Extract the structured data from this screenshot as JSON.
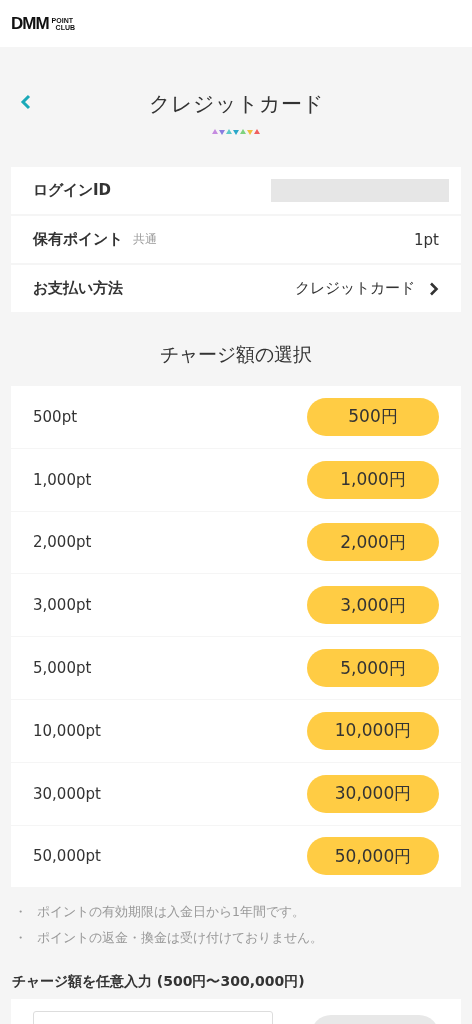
{
  "header": {
    "logo_main": "DMM",
    "logo_sub_1": "POINT",
    "logo_sub_2": "CLUB"
  },
  "page": {
    "title": "クレジットカード"
  },
  "info_rows": [
    {
      "kind": "redacted",
      "label": "ログインID"
    },
    {
      "kind": "value",
      "label": "保有ポイント",
      "note": "共通",
      "value": "1pt"
    },
    {
      "kind": "link",
      "label": "お支払い方法",
      "value": "クレジットカード"
    }
  ],
  "charge_section": {
    "title": "チャージ額の選択",
    "options": [
      {
        "points": "500pt",
        "price": "500円"
      },
      {
        "points": "1,000pt",
        "price": "1,000円"
      },
      {
        "points": "2,000pt",
        "price": "2,000円"
      },
      {
        "points": "3,000pt",
        "price": "3,000円"
      },
      {
        "points": "5,000pt",
        "price": "5,000円"
      },
      {
        "points": "10,000pt",
        "price": "10,000円"
      },
      {
        "points": "30,000pt",
        "price": "30,000円"
      },
      {
        "points": "50,000pt",
        "price": "50,000円"
      }
    ]
  },
  "notes": [
    {
      "bullet": "・",
      "text": "ポイントの有効期限は入金日から1年間です。"
    },
    {
      "bullet": "・",
      "text": "ポイントの返金・換金は受け付けておりません。"
    }
  ],
  "custom_amount": {
    "title": "チャージ額を任意入力 (500円〜300,000円)"
  }
}
